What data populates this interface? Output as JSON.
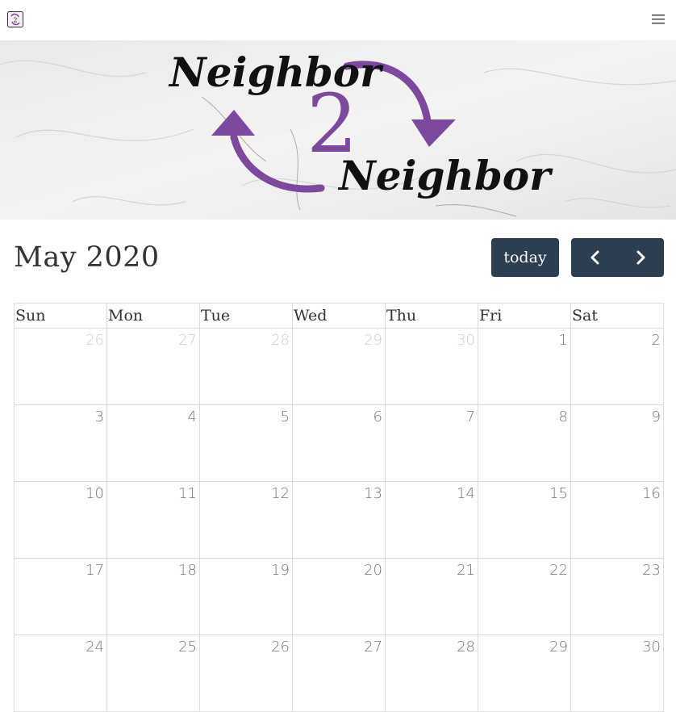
{
  "nav": {
    "logo_icon": "neighbor2neighbor-logo-icon",
    "menu_icon": "hamburger-menu-icon"
  },
  "banner": {
    "word_top": "Neighbor",
    "numeral": "2",
    "word_bottom": "Neighbor",
    "accent_color": "#7b4a9e"
  },
  "calendar": {
    "title": "May 2020",
    "today_label": "today",
    "prev_icon": "chevron-left-icon",
    "next_icon": "chevron-right-icon",
    "button_color": "#2c3e50",
    "weekdays": [
      "Sun",
      "Mon",
      "Tue",
      "Wed",
      "Thu",
      "Fri",
      "Sat"
    ],
    "weeks": [
      [
        {
          "d": "26",
          "other": true
        },
        {
          "d": "27",
          "other": true
        },
        {
          "d": "28",
          "other": true
        },
        {
          "d": "29",
          "other": true
        },
        {
          "d": "30",
          "other": true
        },
        {
          "d": "1",
          "other": false
        },
        {
          "d": "2",
          "other": false
        }
      ],
      [
        {
          "d": "3",
          "other": false
        },
        {
          "d": "4",
          "other": false
        },
        {
          "d": "5",
          "other": false
        },
        {
          "d": "6",
          "other": false
        },
        {
          "d": "7",
          "other": false
        },
        {
          "d": "8",
          "other": false
        },
        {
          "d": "9",
          "other": false
        }
      ],
      [
        {
          "d": "10",
          "other": false
        },
        {
          "d": "11",
          "other": false
        },
        {
          "d": "12",
          "other": false
        },
        {
          "d": "13",
          "other": false
        },
        {
          "d": "14",
          "other": false
        },
        {
          "d": "15",
          "other": false
        },
        {
          "d": "16",
          "other": false
        }
      ],
      [
        {
          "d": "17",
          "other": false
        },
        {
          "d": "18",
          "other": false
        },
        {
          "d": "19",
          "other": false
        },
        {
          "d": "20",
          "other": false
        },
        {
          "d": "21",
          "other": false
        },
        {
          "d": "22",
          "other": false
        },
        {
          "d": "23",
          "other": false
        }
      ],
      [
        {
          "d": "24",
          "other": false
        },
        {
          "d": "25",
          "other": false
        },
        {
          "d": "26",
          "other": false
        },
        {
          "d": "27",
          "other": false
        },
        {
          "d": "28",
          "other": false
        },
        {
          "d": "29",
          "other": false
        },
        {
          "d": "30",
          "other": false
        }
      ]
    ]
  }
}
